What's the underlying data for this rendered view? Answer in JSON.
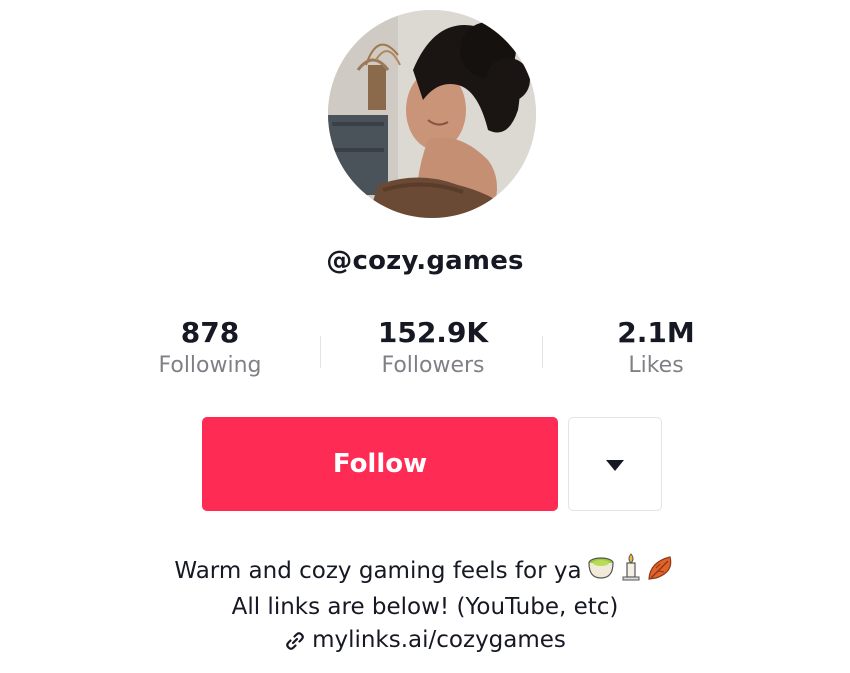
{
  "profile": {
    "username": "@cozy.games",
    "avatar_icon": "profile-photo"
  },
  "stats": {
    "following": {
      "value": "878",
      "label": "Following"
    },
    "followers": {
      "value": "152.9K",
      "label": "Followers"
    },
    "likes": {
      "value": "2.1M",
      "label": "Likes"
    }
  },
  "actions": {
    "follow_label": "Follow",
    "more_icon": "caret-down-icon"
  },
  "bio": {
    "line1": "Warm and cozy gaming feels for ya",
    "line2": "All links are below! (YouTube, etc)",
    "emojis": [
      "tea-bowl-emoji",
      "candle-emoji",
      "fallen-leaf-emoji"
    ]
  },
  "link": {
    "text": "mylinks.ai/cozygames",
    "icon": "link-icon"
  },
  "colors": {
    "accent": "#fe2c55",
    "text": "#161823",
    "muted": "#8a8b91"
  }
}
